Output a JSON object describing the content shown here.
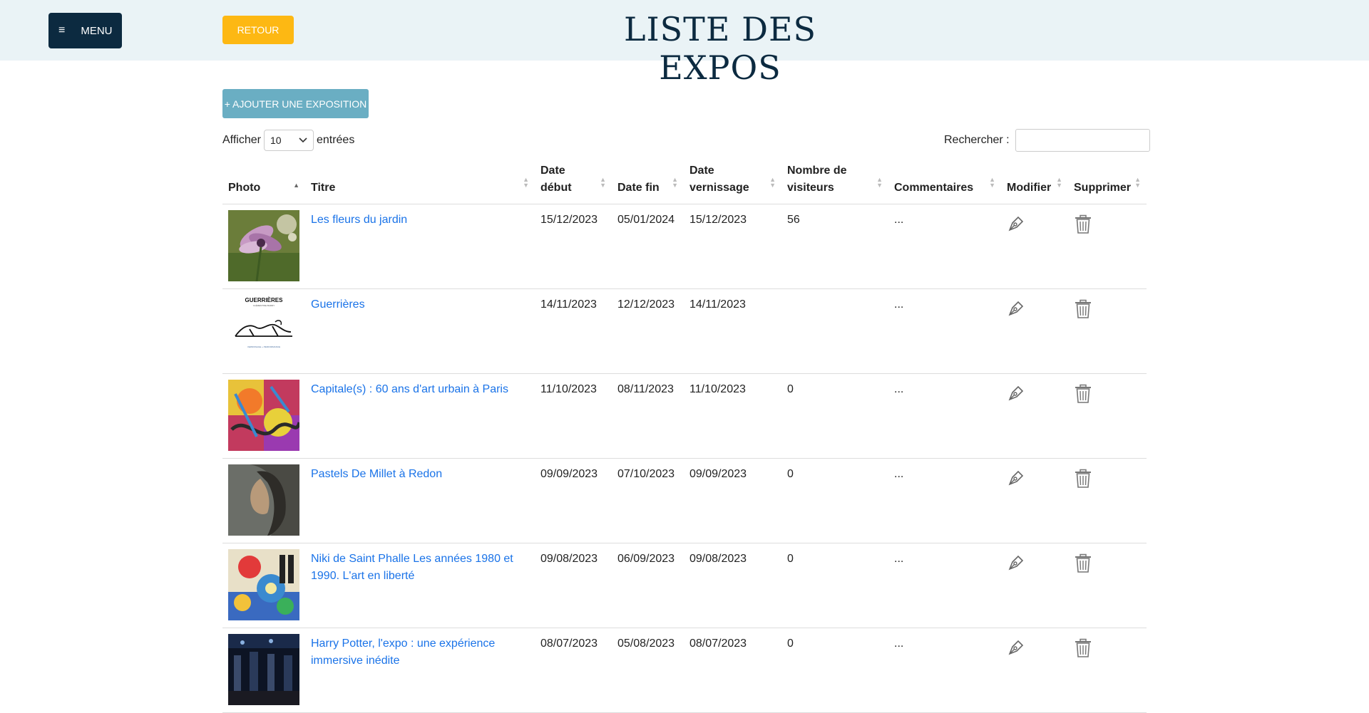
{
  "header": {
    "menu_label": "MENU",
    "retour_label": "RETOUR",
    "title": "LISTE DES EXPOS"
  },
  "toolbar": {
    "add_label": "+ AJOUTER UNE EXPOSITION",
    "show_prefix": "Afficher",
    "show_value": "10",
    "show_suffix": "entrées",
    "search_label": "Rechercher :"
  },
  "table": {
    "columns": [
      "Photo",
      "Titre",
      "Date début",
      "Date fin",
      "Date vernissage",
      "Nombre de visiteurs",
      "Commentaires",
      "Modifier",
      "Supprimer"
    ],
    "rows": [
      {
        "title": "Les fleurs du jardin",
        "start": "15/12/2023",
        "end": "05/01/2024",
        "vernissage": "15/12/2023",
        "visitors": "56",
        "comments": "...",
        "thumb": "flowers"
      },
      {
        "title": "Guerrières",
        "start": "14/11/2023",
        "end": "12/12/2023",
        "vernissage": "14/11/2023",
        "visitors": "",
        "comments": "...",
        "thumb": "guerrieres"
      },
      {
        "title": "Capitale(s) : 60 ans d'art urbain à Paris",
        "start": "11/10/2023",
        "end": "08/11/2023",
        "vernissage": "11/10/2023",
        "visitors": "0",
        "comments": "...",
        "thumb": "graffiti"
      },
      {
        "title": "Pastels De Millet à Redon",
        "start": "09/09/2023",
        "end": "07/10/2023",
        "vernissage": "09/09/2023",
        "visitors": "0",
        "comments": "...",
        "thumb": "pastel"
      },
      {
        "title": "Niki de Saint Phalle Les années 1980 et 1990. L'art en liberté",
        "start": "09/08/2023",
        "end": "06/09/2023",
        "vernissage": "09/08/2023",
        "visitors": "0",
        "comments": "...",
        "thumb": "niki"
      },
      {
        "title": "Harry Potter, l'expo : une expérience immersive inédite",
        "start": "08/07/2023",
        "end": "05/08/2023",
        "vernissage": "08/07/2023",
        "visitors": "0",
        "comments": "...",
        "thumb": "harry"
      }
    ]
  },
  "thumb_texts": {
    "guerrieres_title": "GUERRIÈRES",
    "guerrieres_sub": "CLÉMENTINE BARRY",
    "guerrieres_foot": "VERNISSAGE + PERFORMANCE"
  },
  "colors": {
    "header_bg": "#eaf3f6",
    "menu_bg": "#0c2a40",
    "retour_bg": "#fdb813",
    "add_bg": "#6aaec3",
    "link": "#1a73e8"
  }
}
